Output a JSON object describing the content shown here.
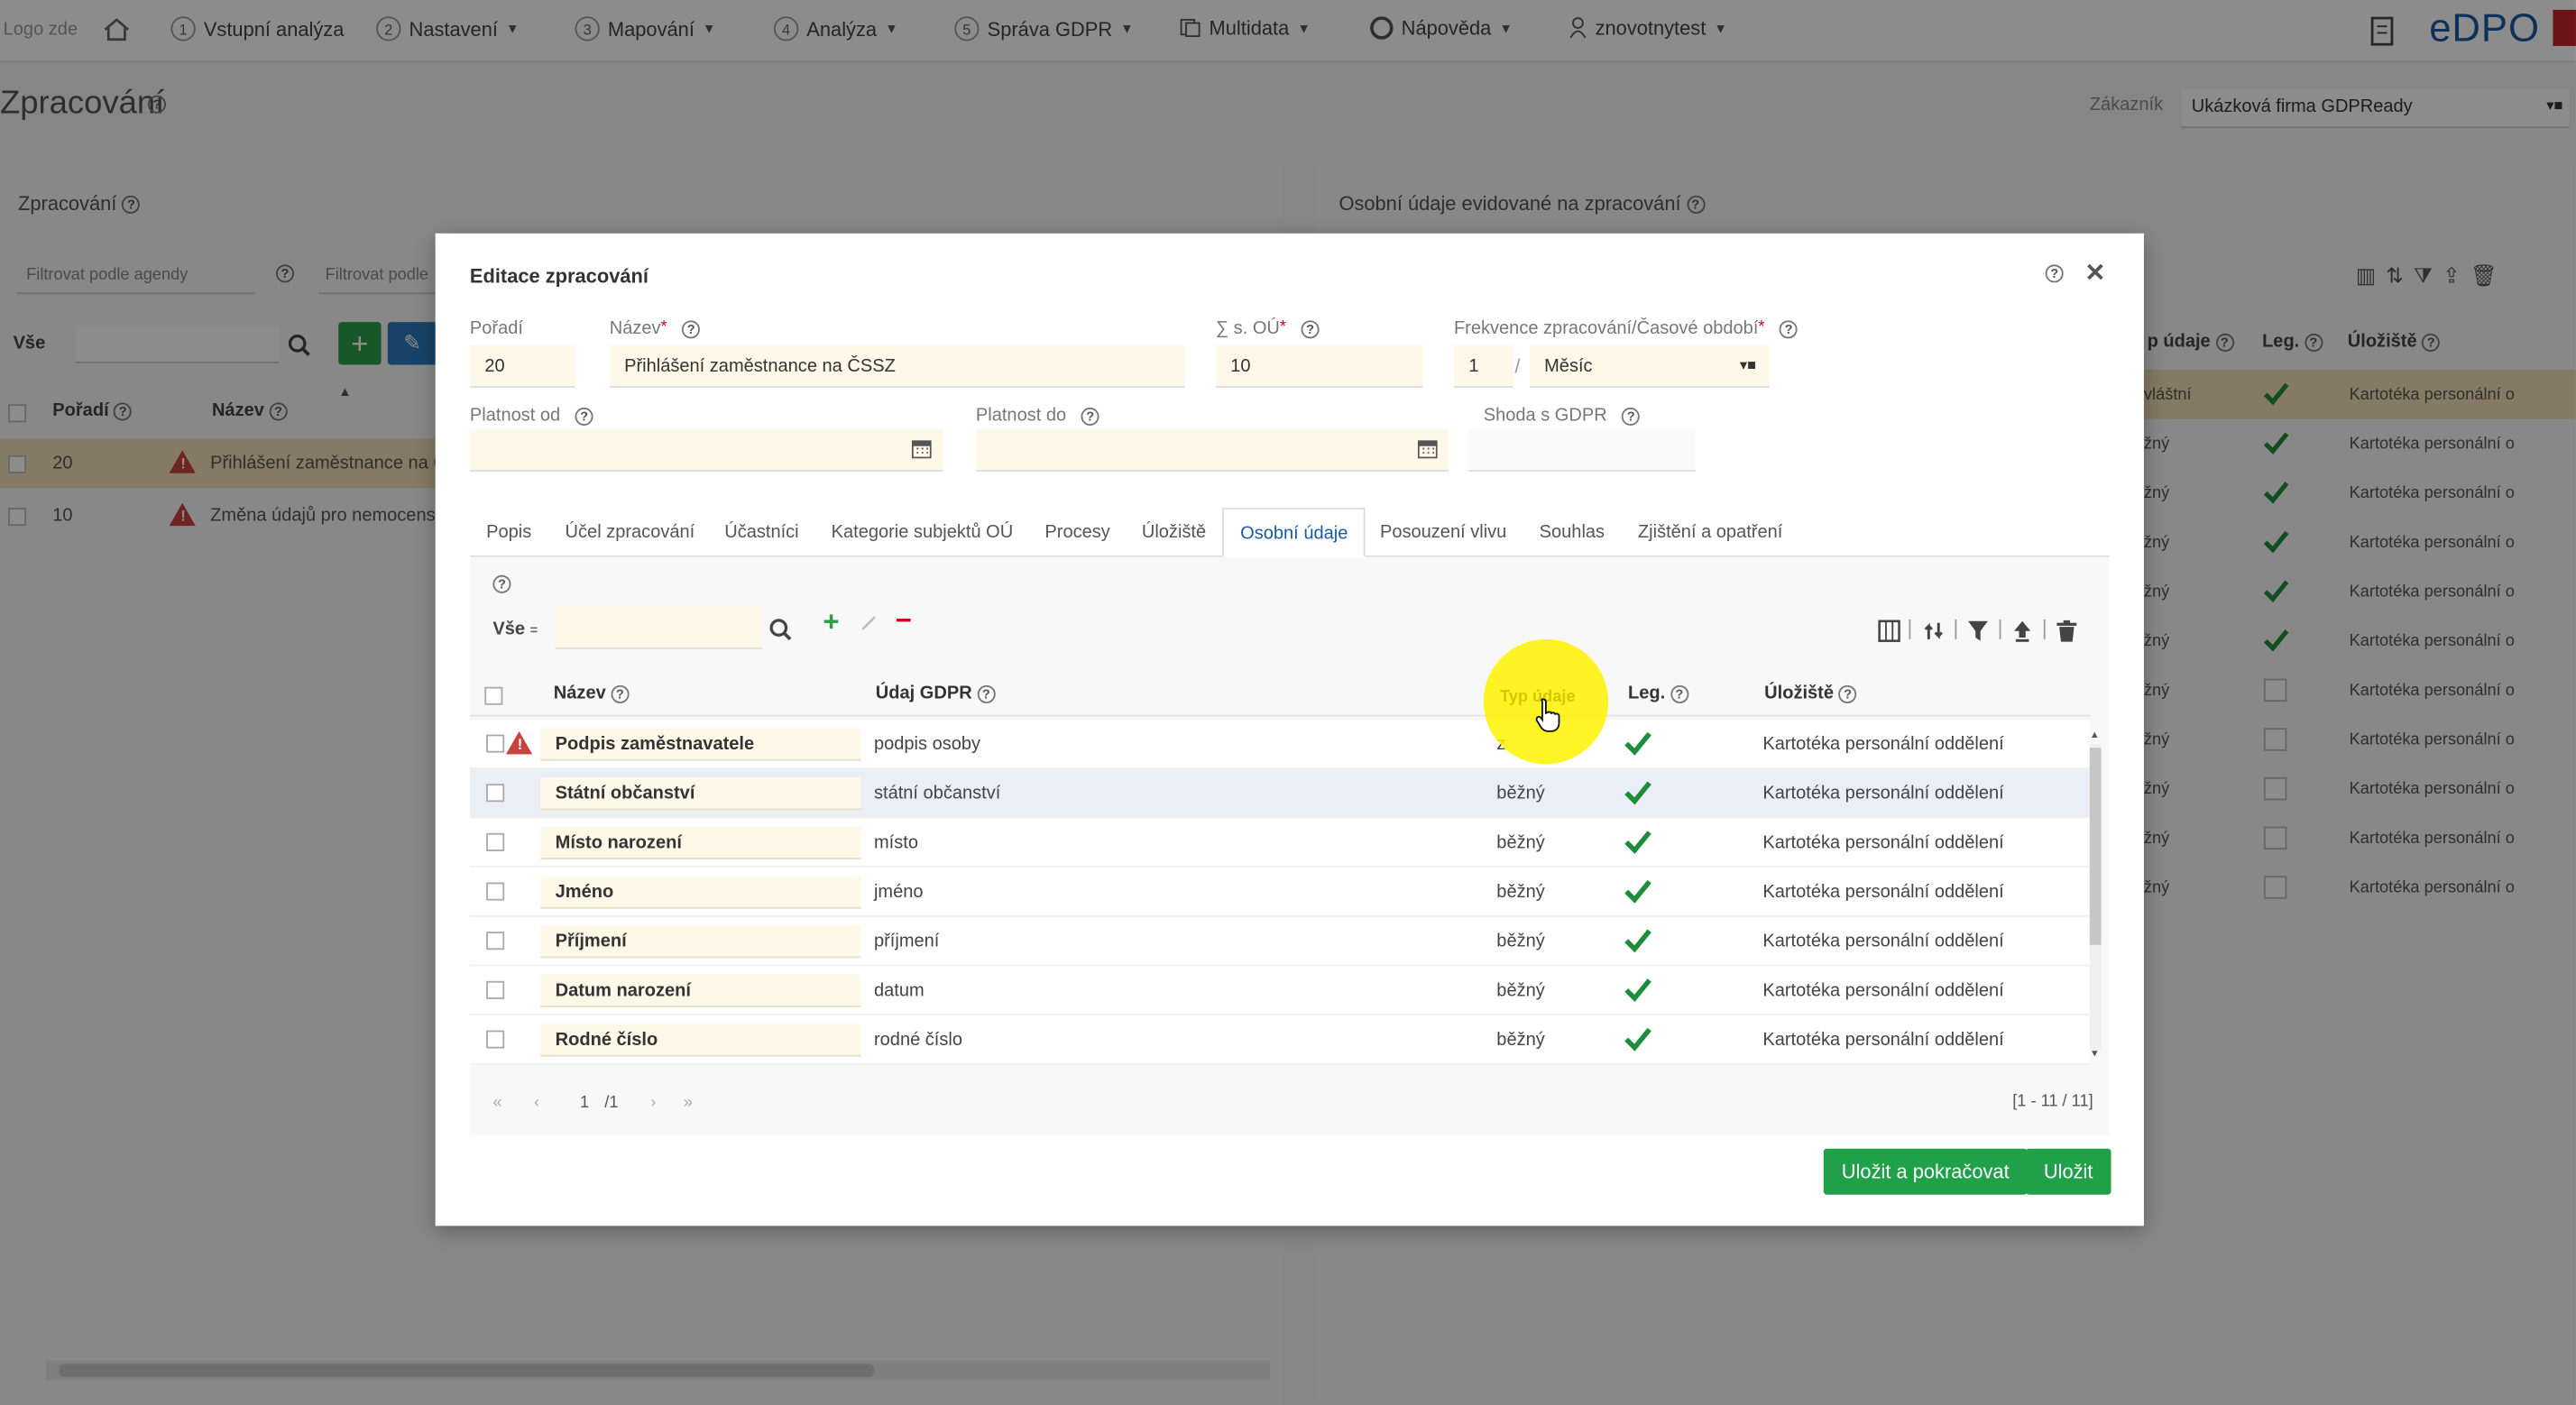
{
  "nav": {
    "logo": "Logo zde",
    "items": [
      {
        "num": "1",
        "label": "Vstupní analýza",
        "caret": false
      },
      {
        "num": "2",
        "label": "Nastavení",
        "caret": true
      },
      {
        "num": "3",
        "label": "Mapování",
        "caret": true
      },
      {
        "num": "4",
        "label": "Analýza",
        "caret": true
      },
      {
        "num": "5",
        "label": "Správa GDPR",
        "caret": true
      }
    ],
    "multidata": "Multidata",
    "napoveda": "Nápověda",
    "user": "znovotnytest",
    "brand": "eDPO"
  },
  "page": {
    "title": "Zpracování",
    "customer_label": "Zákazník",
    "customer_value": "Ukázková firma GDPReady"
  },
  "left_panel": {
    "title": "Zpracování",
    "filter1": "Filtrovat podle agendy",
    "filter2": "Filtrovat podle",
    "all_label": "Vše",
    "headers": [
      "Pořadí",
      "Název"
    ],
    "rows": [
      {
        "order": "20",
        "name": "Přihlášení zaměstnance na Č",
        "highlight": true
      },
      {
        "order": "10",
        "name": "Změna údajů pro nemocens",
        "highlight": false
      }
    ]
  },
  "right_panel": {
    "title": "Osobní údaje evidované na zpracování",
    "headers": [
      "p údaje",
      "Leg.",
      "Úložiště"
    ],
    "rows": [
      {
        "typ": "vláštní",
        "leg": true,
        "ulo": "Kartotéka personální o",
        "highlight": true
      },
      {
        "typ": "žný",
        "leg": true,
        "ulo": "Kartotéka personální o",
        "highlight": false
      },
      {
        "typ": "žný",
        "leg": true,
        "ulo": "Kartotéka personální o",
        "highlight": false
      },
      {
        "typ": "žný",
        "leg": true,
        "ulo": "Kartotéka personální o",
        "highlight": false
      },
      {
        "typ": "žný",
        "leg": true,
        "ulo": "Kartotéka personální o",
        "highlight": false
      },
      {
        "typ": "žný",
        "leg": true,
        "ulo": "Kartotéka personální o",
        "highlight": false
      },
      {
        "typ": "žný",
        "leg": false,
        "ulo": "Kartotéka personální o",
        "highlight": false
      },
      {
        "typ": "žný",
        "leg": false,
        "ulo": "Kartotéka personální o",
        "highlight": false
      },
      {
        "typ": "žný",
        "leg": false,
        "ulo": "Kartotéka personální o",
        "highlight": false
      },
      {
        "typ": "žný",
        "leg": false,
        "ulo": "Kartotéka personální o",
        "highlight": false
      },
      {
        "typ": "žný",
        "leg": false,
        "ulo": "Kartotéka personální o",
        "highlight": false
      }
    ]
  },
  "modal": {
    "title": "Editace zpracování",
    "fields": {
      "poradi_label": "Pořadí",
      "poradi_value": "20",
      "nazev_label": "Název",
      "nazev_value": "Přihlášení zaměstnance na ČSSZ",
      "sou_label": "∑ s. OÚ",
      "sou_value": "10",
      "frekvence_label": "Frekvence zpracování/Časové období",
      "frekvence_num": "1",
      "frekvence_sep": "/",
      "frekvence_unit": "Měsíc",
      "platnost_od_label": "Platnost od",
      "platnost_do_label": "Platnost do",
      "shoda_label": "Shoda s GDPR"
    },
    "tabs": [
      "Popis",
      "Účel zpracování",
      "Účastníci",
      "Kategorie subjektů OÚ",
      "Procesy",
      "Úložiště",
      "Osobní údaje",
      "Posouzení vlivu",
      "Souhlas",
      "Zjištění a opatření"
    ],
    "active_tab": "Osobní údaje",
    "table": {
      "all_label": "Vše",
      "headers": {
        "nazev": "Název",
        "udaj": "Údaj GDPR",
        "typ": "Typ údaje",
        "leg": "Leg.",
        "ulo": "Úložiště"
      },
      "rows": [
        {
          "nazev": "Podpis zaměstnavatele",
          "udaj": "podpis osoby",
          "typ": "z",
          "leg": true,
          "ulo": "Kartotéka personální oddělení",
          "warn": true,
          "selected": false
        },
        {
          "nazev": "Státní občanství",
          "udaj": "státní občanství",
          "typ": "běžný",
          "leg": true,
          "ulo": "Kartotéka personální oddělení",
          "warn": false,
          "selected": true
        },
        {
          "nazev": "Místo narození",
          "udaj": "místo",
          "typ": "běžný",
          "leg": true,
          "ulo": "Kartotéka personální oddělení",
          "warn": false,
          "selected": false
        },
        {
          "nazev": "Jméno",
          "udaj": "jméno",
          "typ": "běžný",
          "leg": true,
          "ulo": "Kartotéka personální oddělení",
          "warn": false,
          "selected": false
        },
        {
          "nazev": "Příjmení",
          "udaj": "příjmení",
          "typ": "běžný",
          "leg": true,
          "ulo": "Kartotéka personální oddělení",
          "warn": false,
          "selected": false
        },
        {
          "nazev": "Datum narození",
          "udaj": "datum",
          "typ": "běžný",
          "leg": true,
          "ulo": "Kartotéka personální oddělení",
          "warn": false,
          "selected": false
        },
        {
          "nazev": "Rodné číslo",
          "udaj": "rodné číslo",
          "typ": "běžný",
          "leg": true,
          "ulo": "Kartotéka personální oddělení",
          "warn": false,
          "selected": false
        }
      ],
      "pager": {
        "page": "1",
        "total": "/1",
        "range": "[1 - 11 / 11]"
      }
    },
    "buttons": {
      "save_continue": "Uložit a pokračovat",
      "save": "Uložit"
    }
  },
  "colors": {
    "accent": "#1fa049",
    "brand": "#1a5aa5",
    "highlight_row": "#f2dfb6",
    "input_bg": "#fdf8e8",
    "warning": "#c8423e",
    "cursor_highlight": "#fff200"
  }
}
